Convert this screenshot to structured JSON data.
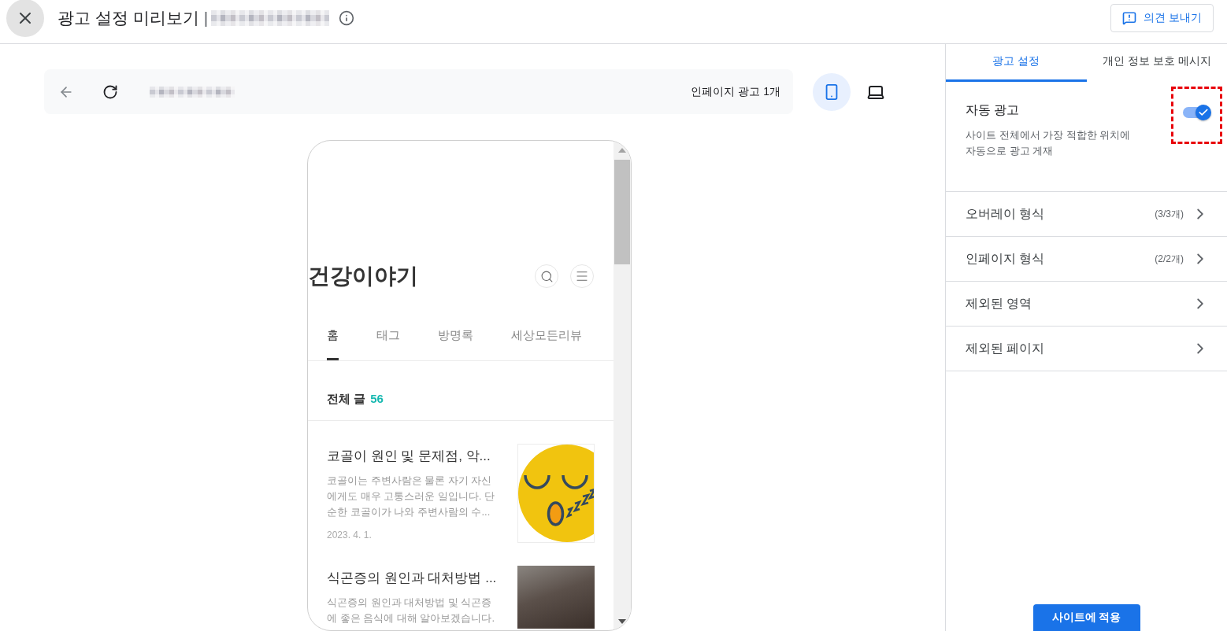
{
  "header": {
    "title": "광고 설정 미리보기",
    "separator": "|",
    "feedback_button": "의견 보내기"
  },
  "preview": {
    "ad_count": "인페이지 광고 1개",
    "devices": [
      {
        "kind": "mobile",
        "selected": true
      },
      {
        "kind": "desktop",
        "selected": false
      }
    ],
    "blog": {
      "title": "건강이야기",
      "nav": [
        {
          "label": "홈",
          "selected": true
        },
        {
          "label": "태그",
          "selected": false
        },
        {
          "label": "방명록",
          "selected": false
        },
        {
          "label": "세상모든리뷰",
          "selected": false
        }
      ],
      "count_label": "전체 글",
      "count": "56",
      "posts": [
        {
          "kind": "emoji",
          "title": "코골이 원인 및 문제점, 악...",
          "excerpt": "코골이는 주변사람은 물론 자기 자신에게도 매우 고통스러운 일입니다. 단순한 코골이가 나와 주변사람의 수...",
          "date": "2023. 4. 1."
        },
        {
          "kind": "photo",
          "title": "식곤증의 원인과 대처방법 ...",
          "excerpt": "식곤증의 원인과 대처방법 및 식곤증에 좋은 음식에 대해 알아보겠습니다."
        }
      ]
    }
  },
  "settings": {
    "tabs": [
      {
        "label": "광고 설정",
        "selected": true
      },
      {
        "label": "개인 정보 보호 메시지",
        "selected": false
      }
    ],
    "auto_ads": {
      "title": "자동 광고",
      "description": "사이트 전체에서 가장 적합한 위치에 자동으로 광고 게재",
      "on": true,
      "highlighted": true
    },
    "rows": [
      {
        "label": "오버레이 형식",
        "count": "(3/3개)"
      },
      {
        "label": "인페이지 형식",
        "count": "(2/2개)"
      },
      {
        "label": "제외된 영역"
      },
      {
        "label": "제외된 페이지"
      }
    ],
    "apply_button": "사이트에 적용"
  }
}
